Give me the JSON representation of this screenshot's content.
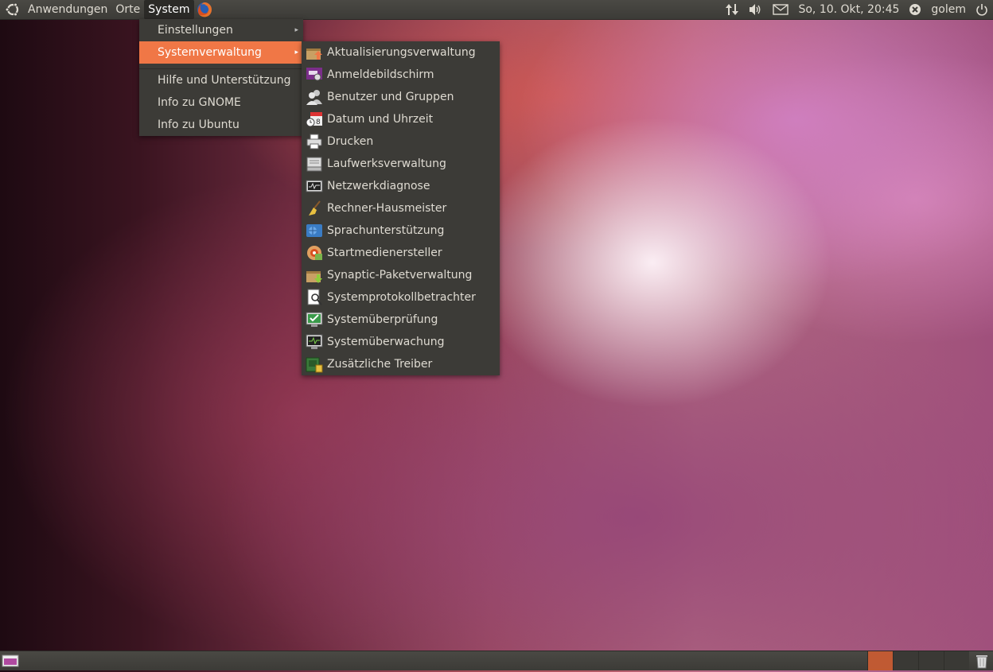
{
  "top_panel": {
    "menus": [
      "Anwendungen",
      "Orte",
      "System"
    ],
    "clock": "So, 10. Okt, 20:45",
    "user": "golem",
    "icons": [
      "ubuntu-logo",
      "firefox",
      "network-updown",
      "volume",
      "mail",
      "user-status",
      "power"
    ]
  },
  "system_menu": {
    "items": [
      {
        "label": "Einstellungen",
        "submenu": true
      },
      {
        "label": "Systemverwaltung",
        "submenu": true,
        "highlighted": true
      },
      {
        "label": "Hilfe und Unterstützung",
        "submenu": false
      },
      {
        "label": "Info zu GNOME",
        "submenu": false
      },
      {
        "label": "Info zu Ubuntu",
        "submenu": false
      }
    ],
    "highlight_color": "#f07746"
  },
  "admin_submenu": {
    "items": [
      {
        "label": "Aktualisierungsverwaltung",
        "icon": "update-manager-icon"
      },
      {
        "label": "Anmeldebildschirm",
        "icon": "login-screen-icon"
      },
      {
        "label": "Benutzer und Gruppen",
        "icon": "users-icon"
      },
      {
        "label": "Datum und Uhrzeit",
        "icon": "calendar-clock-icon"
      },
      {
        "label": "Drucken",
        "icon": "printer-icon"
      },
      {
        "label": "Laufwerksverwaltung",
        "icon": "disk-drive-icon"
      },
      {
        "label": "Netzwerkdiagnose",
        "icon": "network-tools-icon"
      },
      {
        "label": "Rechner-Hausmeister",
        "icon": "broom-icon"
      },
      {
        "label": "Sprachunterstützung",
        "icon": "language-icon"
      },
      {
        "label": "Startmedienersteller",
        "icon": "usb-creator-icon"
      },
      {
        "label": "Synaptic-Paketverwaltung",
        "icon": "package-icon"
      },
      {
        "label": "Systemprotokollbetrachter",
        "icon": "log-viewer-icon"
      },
      {
        "label": "Systemüberprüfung",
        "icon": "system-test-icon"
      },
      {
        "label": "Systemüberwachung",
        "icon": "system-monitor-icon"
      },
      {
        "label": "Zusätzliche Treiber",
        "icon": "drivers-icon"
      }
    ]
  },
  "bottom_panel": {
    "workspaces": 4,
    "active_workspace": 1,
    "icons": [
      "show-desktop",
      "trash"
    ]
  }
}
